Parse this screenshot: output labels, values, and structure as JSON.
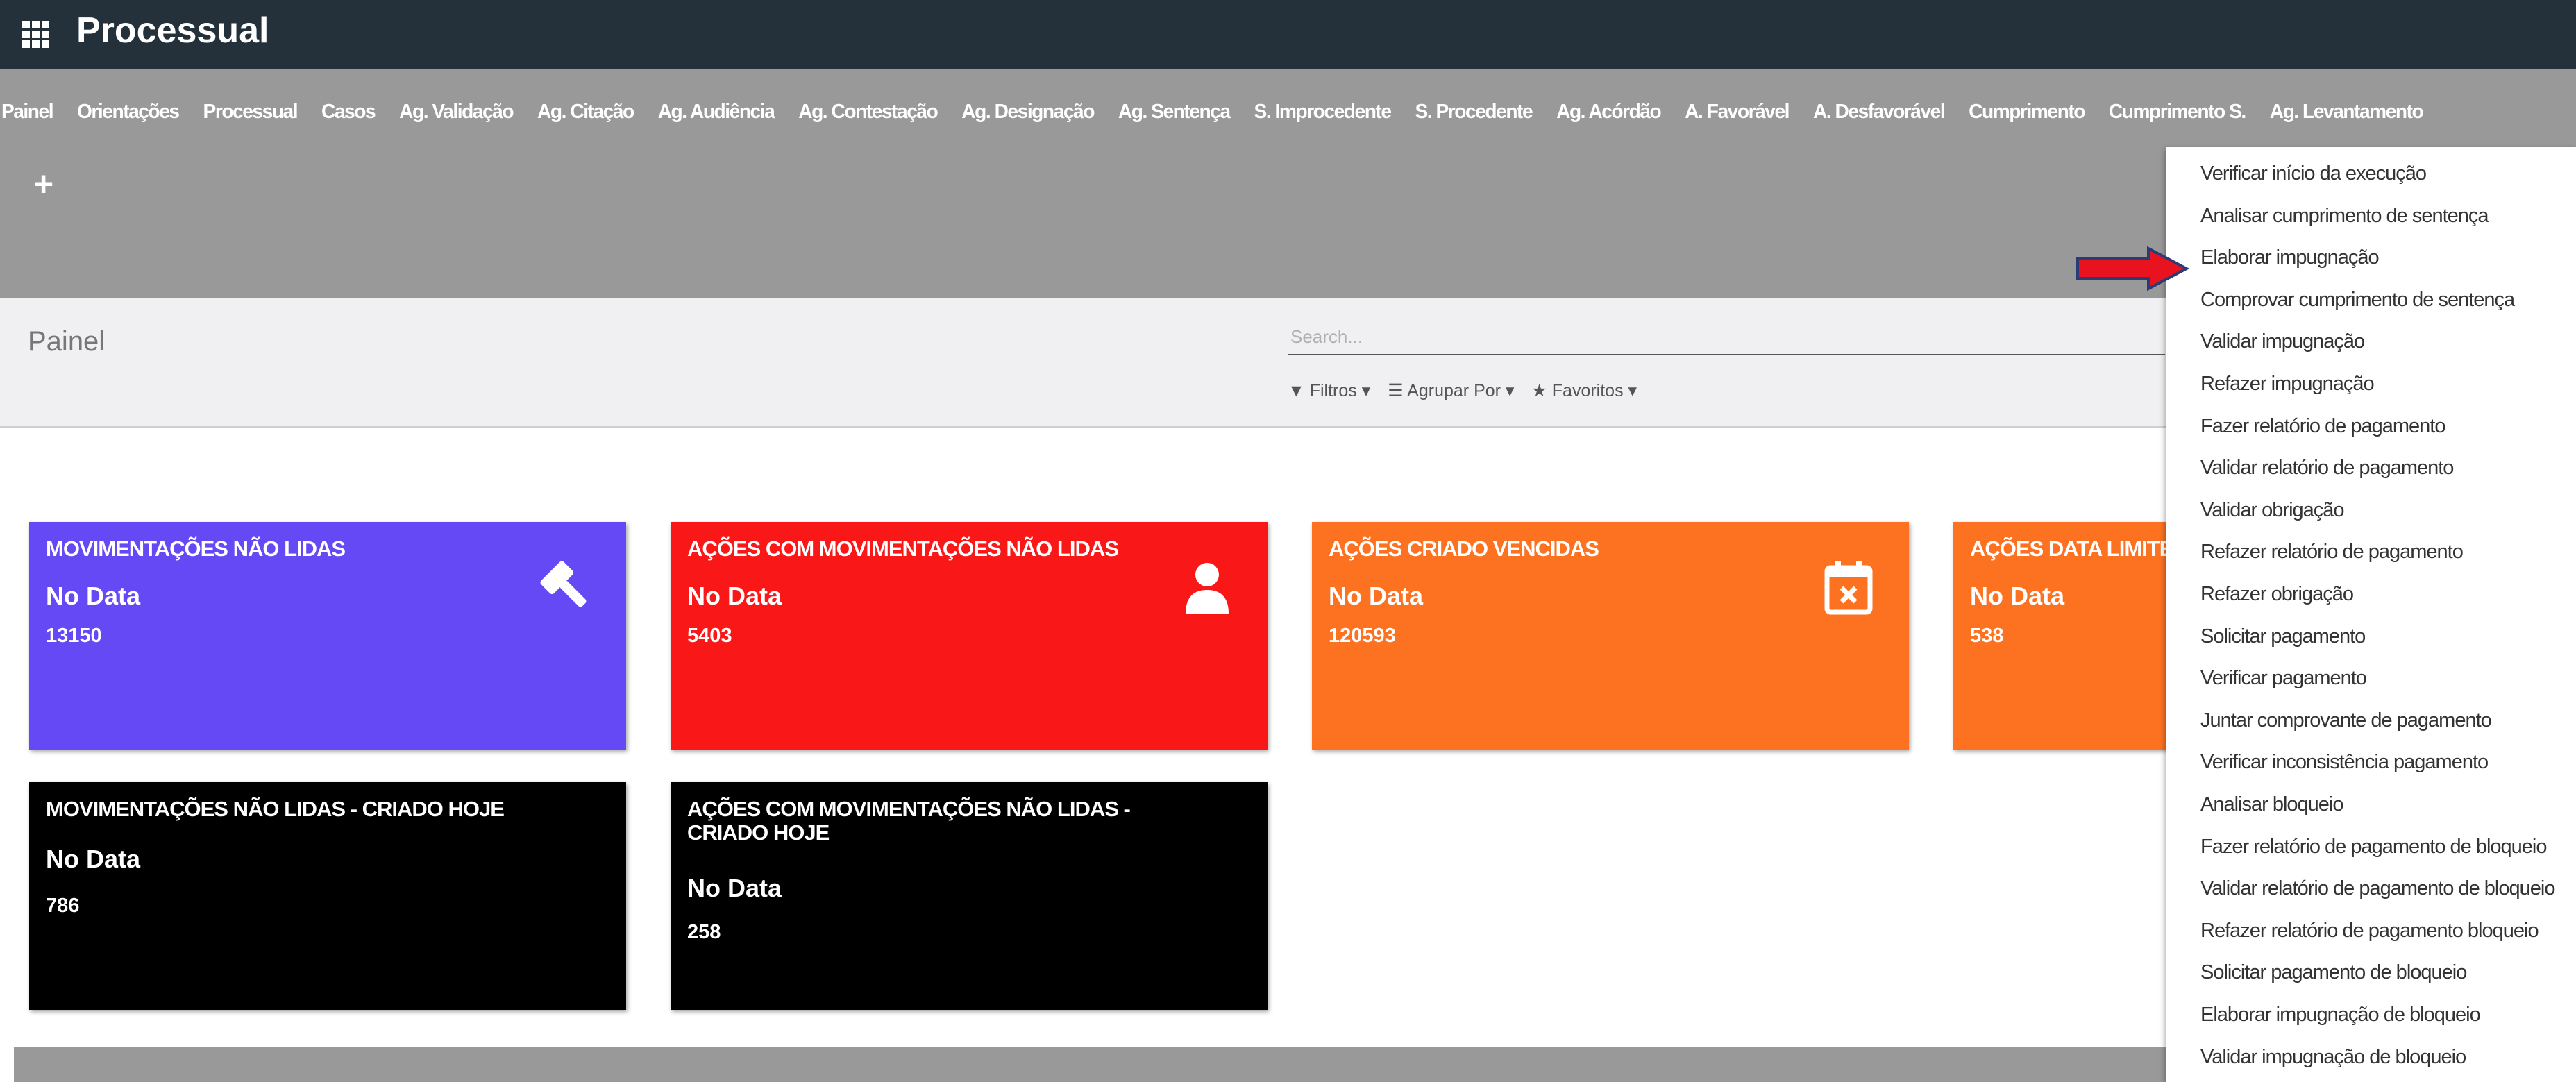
{
  "app": {
    "title": "Processual"
  },
  "menu": {
    "items": [
      "Painel",
      "Orientações",
      "Processual",
      "Casos",
      "Ag. Validação",
      "Ag. Citação",
      "Ag. Audiência",
      "Ag. Contestação",
      "Ag. Designação",
      "Ag. Sentença",
      "S. Improcedente",
      "S. Procedente",
      "Ag. Acórdão",
      "A. Favorável",
      "A. Desfavorável",
      "Cumprimento",
      "Cumprimento S.",
      "Ag. Levantamento"
    ],
    "plus": "+"
  },
  "control_panel": {
    "breadcrumb": "Painel",
    "search_placeholder": "Search...",
    "filters": "▼ Filtros ▾",
    "group_by": "☰ Agrupar Por ▾",
    "favorites": "★ Favoritos ▾"
  },
  "tiles": [
    {
      "title": "MOVIMENTAÇÕES NÃO LIDAS",
      "status": "No Data",
      "count": "13150",
      "color": "#6549f5",
      "icon": "gavel-icon"
    },
    {
      "title": "AÇÕES COM MOVIMENTAÇÕES NÃO LIDAS",
      "status": "No Data",
      "count": "5403",
      "color": "#fa1718",
      "icon": "user-icon"
    },
    {
      "title": "AÇÕES CRIADO VENCIDAS",
      "status": "No Data",
      "count": "120593",
      "color": "#fc7221",
      "icon": "calendar-x-icon"
    },
    {
      "title": "AÇÕES DATA LIMITE",
      "status": "No Data",
      "count": "538",
      "color": "#fc7221",
      "icon": ""
    },
    {
      "title": "MOVIMENTAÇÕES NÃO LIDAS - CRIADO HOJE",
      "status": "No Data",
      "count": "786",
      "color": "#000000",
      "icon": ""
    },
    {
      "title": "AÇÕES COM MOVIMENTAÇÕES NÃO LIDAS - CRIADO HOJE",
      "status": "No Data",
      "count": "258",
      "color": "#000000",
      "icon": ""
    }
  ],
  "dropdown": {
    "items": [
      "Verificar início da execução",
      "Analisar cumprimento de sentença",
      "Elaborar impugnação",
      "Comprovar cumprimento de sentença",
      "Validar impugnação",
      "Refazer impugnação",
      "Fazer relatório de pagamento",
      "Validar relatório de pagamento",
      "Validar obrigação",
      "Refazer relatório de pagamento",
      "Refazer obrigação",
      "Solicitar pagamento",
      "Verificar pagamento",
      "Juntar comprovante de pagamento",
      "Verificar inconsistência pagamento",
      "Analisar bloqueio",
      "Fazer relatório de pagamento de bloqueio",
      "Validar relatório de pagamento de bloqueio",
      "Refazer relatório de pagamento bloqueio",
      "Solicitar pagamento de bloqueio",
      "Elaborar impugnação de bloqueio",
      "Validar impugnação de bloqueio"
    ],
    "highlighted": "Elaborar impugnação"
  },
  "colors": {
    "topbar": "#24313a",
    "menubar": "#999999",
    "arrow": "#e8131f",
    "arrow_outline": "#2a3c78"
  }
}
